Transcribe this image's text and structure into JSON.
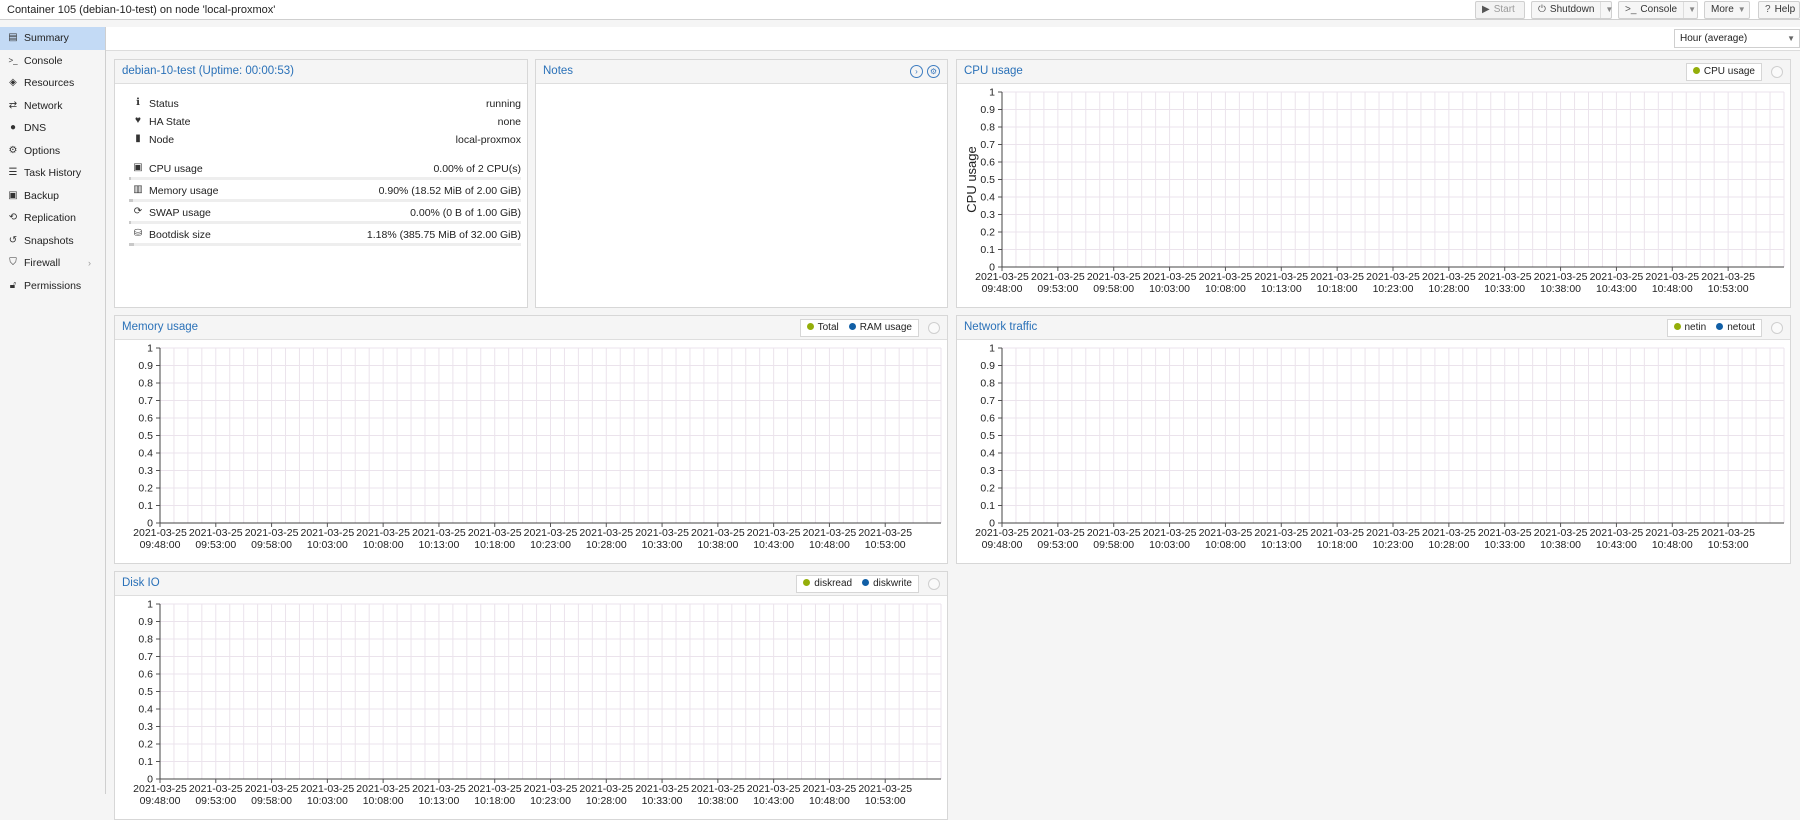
{
  "header": {
    "title": "Container 105 (debian-10-test) on node 'local-proxmox'",
    "buttons": {
      "start": "Start",
      "shutdown": "Shutdown",
      "console": "Console",
      "more": "More",
      "help": "Help"
    }
  },
  "sidebar": {
    "items": [
      {
        "label": "Summary",
        "icon": "book-icon",
        "active": true
      },
      {
        "label": "Console",
        "icon": "terminal-icon"
      },
      {
        "label": "Resources",
        "icon": "cube-icon"
      },
      {
        "label": "Network",
        "icon": "exchange-icon"
      },
      {
        "label": "DNS",
        "icon": "globe-icon"
      },
      {
        "label": "Options",
        "icon": "gear-icon"
      },
      {
        "label": "Task History",
        "icon": "list-icon"
      },
      {
        "label": "Backup",
        "icon": "floppy-icon"
      },
      {
        "label": "Replication",
        "icon": "retweet-icon"
      },
      {
        "label": "Snapshots",
        "icon": "history-icon"
      },
      {
        "label": "Firewall",
        "icon": "shield-icon",
        "has_submenu": true
      },
      {
        "label": "Permissions",
        "icon": "unlock-icon"
      }
    ]
  },
  "timeframe": {
    "selected": "Hour (average)"
  },
  "status_panel": {
    "title": "debian-10-test (Uptime: 00:00:53)",
    "rows": [
      {
        "label": "Status",
        "value": "running",
        "icon": "info-icon"
      },
      {
        "label": "HA State",
        "value": "none",
        "icon": "heartbeat-icon"
      },
      {
        "label": "Node",
        "value": "local-proxmox",
        "icon": "building-icon"
      }
    ],
    "usage_rows": [
      {
        "label": "CPU usage",
        "value": "0.00% of 2 CPU(s)",
        "icon": "cpu-icon",
        "fraction": 0.0
      },
      {
        "label": "Memory usage",
        "value": "0.90% (18.52 MiB of 2.00 GiB)",
        "icon": "memory-icon",
        "fraction": 0.009
      },
      {
        "label": "SWAP usage",
        "value": "0.00% (0 B of 1.00 GiB)",
        "icon": "refresh-icon",
        "fraction": 0.0
      },
      {
        "label": "Bootdisk size",
        "value": "1.18% (385.75 MiB of 32.00 GiB)",
        "icon": "hdd-icon",
        "fraction": 0.0118
      }
    ]
  },
  "notes_panel": {
    "title": "Notes"
  },
  "panels": {
    "cpu": {
      "title": "CPU usage",
      "legend": [
        "CPU usage"
      ]
    },
    "memory": {
      "title": "Memory usage",
      "legend": [
        "Total",
        "RAM usage"
      ]
    },
    "network": {
      "title": "Network traffic",
      "legend": [
        "netin",
        "netout"
      ]
    },
    "disk": {
      "title": "Disk IO",
      "legend": [
        "diskread",
        "diskwrite"
      ]
    }
  },
  "colors": {
    "accent": "#2a71b8",
    "series_green": "#94ae0a",
    "series_blue": "#115fa6",
    "active_nav": "#c3daf5"
  },
  "chart_data": [
    {
      "type": "line",
      "title": "CPU usage",
      "ylabel": "CPU usage",
      "ylim": [
        0,
        1
      ],
      "yticks": [
        0,
        0.1,
        0.2,
        0.3,
        0.4,
        0.5,
        0.6,
        0.7,
        0.8,
        0.9,
        1
      ],
      "x_dates": [
        "2021-03-25",
        "2021-03-25",
        "2021-03-25",
        "2021-03-25",
        "2021-03-25",
        "2021-03-25",
        "2021-03-25",
        "2021-03-25",
        "2021-03-25",
        "2021-03-25",
        "2021-03-25",
        "2021-03-25",
        "2021-03-25",
        "2021-03-25"
      ],
      "x_times": [
        "09:48:00",
        "09:53:00",
        "09:58:00",
        "10:03:00",
        "10:08:00",
        "10:13:00",
        "10:18:00",
        "10:23:00",
        "10:28:00",
        "10:33:00",
        "10:38:00",
        "10:43:00",
        "10:48:00",
        "10:53:00"
      ],
      "series": [
        {
          "name": "CPU usage",
          "values": []
        }
      ],
      "grid": true
    },
    {
      "type": "line",
      "title": "Memory usage",
      "ylabel": "",
      "ylim": [
        0,
        1
      ],
      "yticks": [
        0,
        0.1,
        0.2,
        0.3,
        0.4,
        0.5,
        0.6,
        0.7,
        0.8,
        0.9,
        1
      ],
      "x_dates": [
        "2021-03-25",
        "2021-03-25",
        "2021-03-25",
        "2021-03-25",
        "2021-03-25",
        "2021-03-25",
        "2021-03-25",
        "2021-03-25",
        "2021-03-25",
        "2021-03-25",
        "2021-03-25",
        "2021-03-25",
        "2021-03-25",
        "2021-03-25"
      ],
      "x_times": [
        "09:48:00",
        "09:53:00",
        "09:58:00",
        "10:03:00",
        "10:08:00",
        "10:13:00",
        "10:18:00",
        "10:23:00",
        "10:28:00",
        "10:33:00",
        "10:38:00",
        "10:43:00",
        "10:48:00",
        "10:53:00"
      ],
      "series": [
        {
          "name": "Total",
          "values": []
        },
        {
          "name": "RAM usage",
          "values": []
        }
      ],
      "grid": true
    },
    {
      "type": "line",
      "title": "Network traffic",
      "ylabel": "",
      "ylim": [
        0,
        1
      ],
      "yticks": [
        0,
        0.1,
        0.2,
        0.3,
        0.4,
        0.5,
        0.6,
        0.7,
        0.8,
        0.9,
        1
      ],
      "x_dates": [
        "2021-03-25",
        "2021-03-25",
        "2021-03-25",
        "2021-03-25",
        "2021-03-25",
        "2021-03-25",
        "2021-03-25",
        "2021-03-25",
        "2021-03-25",
        "2021-03-25",
        "2021-03-25",
        "2021-03-25",
        "2021-03-25",
        "2021-03-25"
      ],
      "x_times": [
        "09:48:00",
        "09:53:00",
        "09:58:00",
        "10:03:00",
        "10:08:00",
        "10:13:00",
        "10:18:00",
        "10:23:00",
        "10:28:00",
        "10:33:00",
        "10:38:00",
        "10:43:00",
        "10:48:00",
        "10:53:00"
      ],
      "series": [
        {
          "name": "netin",
          "values": []
        },
        {
          "name": "netout",
          "values": []
        }
      ],
      "grid": true
    },
    {
      "type": "line",
      "title": "Disk IO",
      "ylabel": "",
      "ylim": [
        0,
        1
      ],
      "yticks": [
        0,
        0.1,
        0.2,
        0.3,
        0.4,
        0.5,
        0.6,
        0.7,
        0.8,
        0.9,
        1
      ],
      "x_dates": [
        "2021-03-25",
        "2021-03-25",
        "2021-03-25",
        "2021-03-25",
        "2021-03-25",
        "2021-03-25",
        "2021-03-25",
        "2021-03-25",
        "2021-03-25",
        "2021-03-25",
        "2021-03-25",
        "2021-03-25",
        "2021-03-25",
        "2021-03-25"
      ],
      "x_times": [
        "09:48:00",
        "09:53:00",
        "09:58:00",
        "10:03:00",
        "10:08:00",
        "10:13:00",
        "10:18:00",
        "10:23:00",
        "10:28:00",
        "10:33:00",
        "10:38:00",
        "10:43:00",
        "10:48:00",
        "10:53:00"
      ],
      "series": [
        {
          "name": "diskread",
          "values": []
        },
        {
          "name": "diskwrite",
          "values": []
        }
      ],
      "grid": true
    }
  ]
}
